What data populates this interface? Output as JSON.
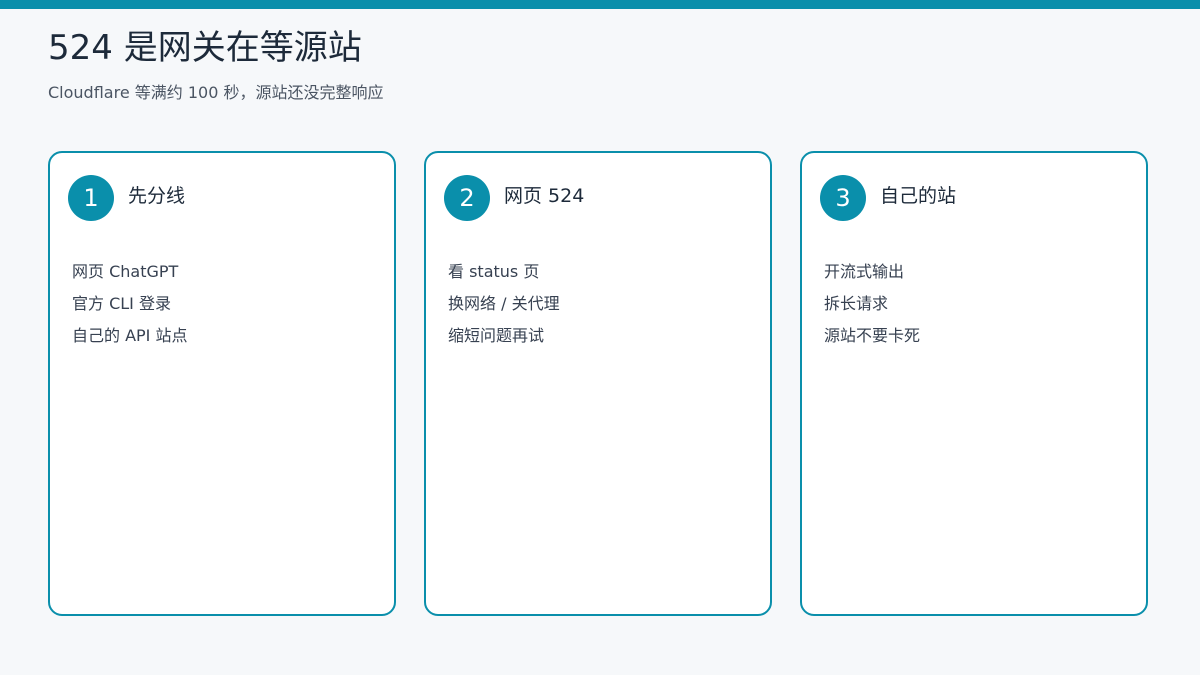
{
  "header": {
    "title": "524 是网关在等源站",
    "subtitle": "Cloudflare 等满约 100 秒，源站还没完整响应"
  },
  "cards": [
    {
      "number": "1",
      "title": "先分线",
      "items": [
        "网页 ChatGPT",
        "官方 CLI 登录",
        "自己的 API 站点"
      ]
    },
    {
      "number": "2",
      "title": "网页 524",
      "items": [
        "看 status 页",
        "换网络 / 关代理",
        "缩短问题再试"
      ]
    },
    {
      "number": "3",
      "title": "自己的站",
      "items": [
        "开流式输出",
        "拆长请求",
        "源站不要卡死"
      ]
    }
  ],
  "colors": {
    "accent": "#0a8fab",
    "background": "#f6f8fa",
    "card_background": "#ffffff"
  }
}
